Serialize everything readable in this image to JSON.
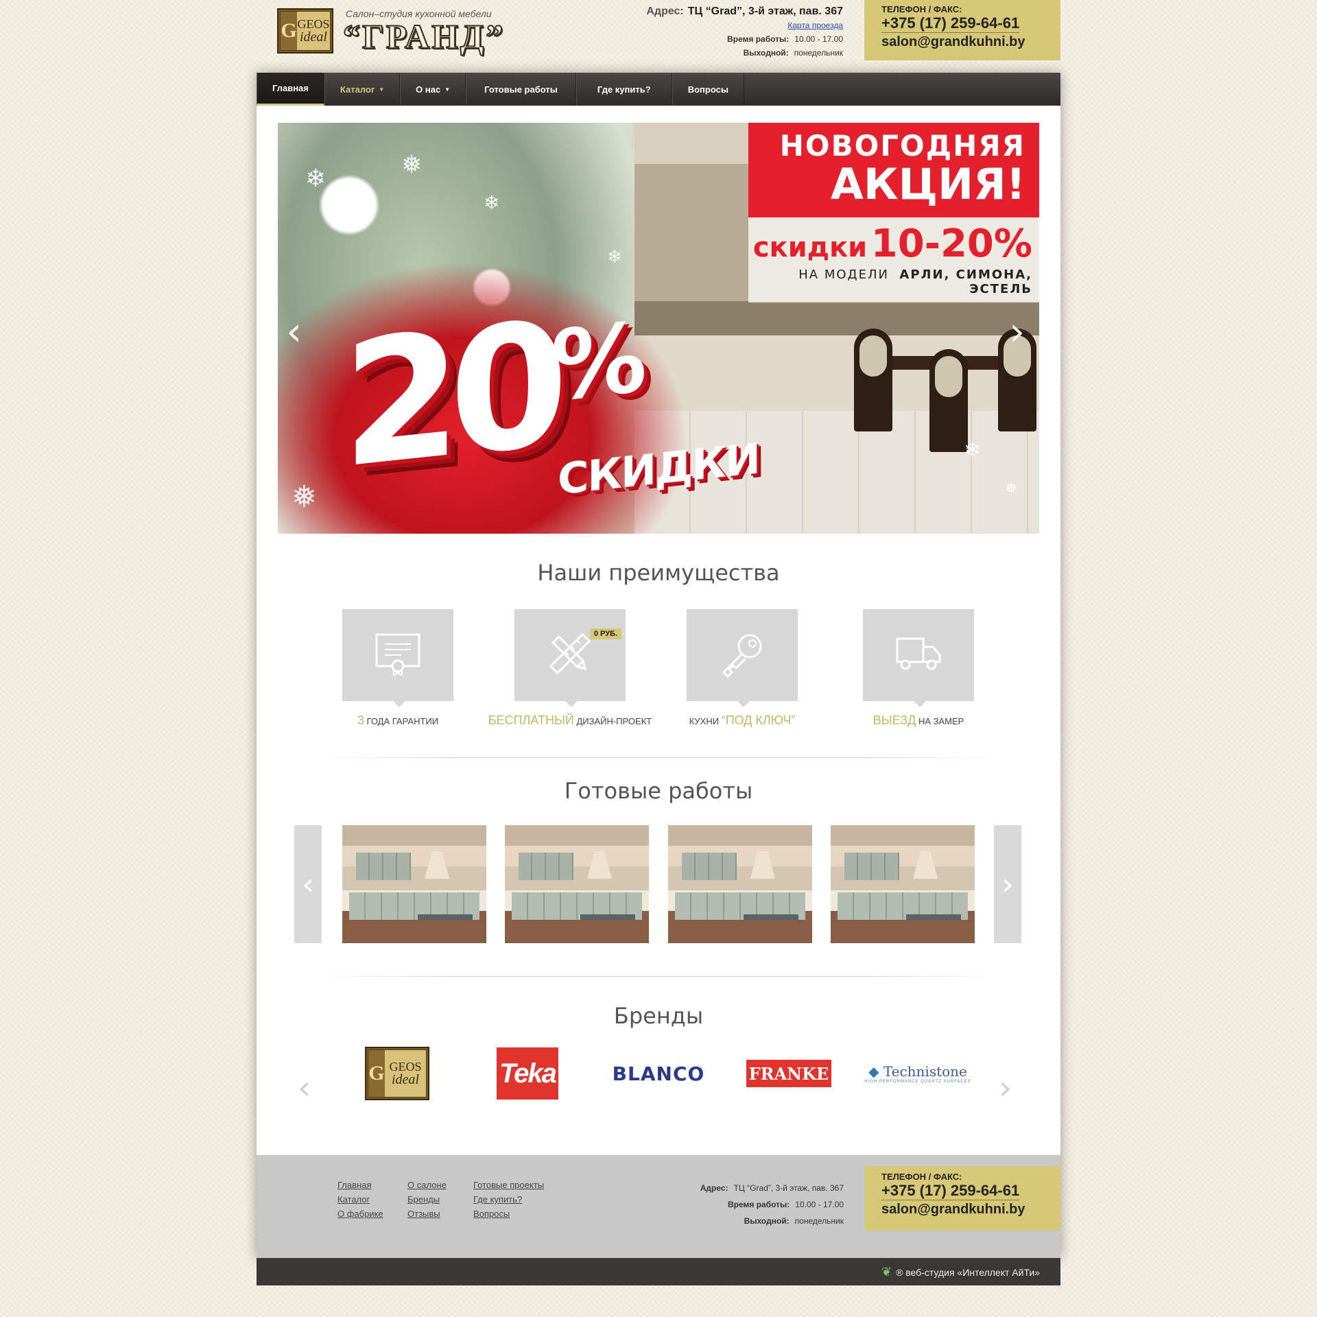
{
  "header": {
    "logo": {
      "letter": "G",
      "line1": "GEOS",
      "line2": "ideal"
    },
    "tagline": "Салон–студия кухонной мебели",
    "brand_name": "“ГРАНД”",
    "address_label": "Адрес:",
    "address": "ТЦ “Grad”, 3-й этаж, пав. 367",
    "map_link": "Карта проезда",
    "hours_label": "Время работы:",
    "hours": "10.00 - 17.00",
    "dayoff_label": "Выходной:",
    "dayoff": "понедельник",
    "contact_label": "ТЕЛЕФОН / ФАКС:",
    "phone": "+375 (17) 259-64-61",
    "email": "salon@grandkuhni.by"
  },
  "nav": [
    {
      "label": "Главная"
    },
    {
      "label": "Каталог"
    },
    {
      "label": "О нас"
    },
    {
      "label": "Готовые работы"
    },
    {
      "label": "Где купить?"
    },
    {
      "label": "Вопросы"
    }
  ],
  "banner": {
    "promo_line1": "НОВОГОДНЯЯ",
    "promo_line2": "АКЦИЯ!",
    "discount_word": "скидки",
    "discount_range": "10-20%",
    "models_prefix": "НА МОДЕЛИ",
    "models": "АРЛИ, СИМОНА, ЭСТЕЛЬ",
    "big_number": "20",
    "big_percent": "%",
    "big_word": "СКИДКИ",
    "arrow_prev": "‹",
    "arrow_next": "›"
  },
  "advantages": {
    "title": "Наши преимущества",
    "items": [
      {
        "icon": "certificate-icon",
        "gold": "3",
        "text": "года гарантии"
      },
      {
        "icon": "pencil-ruler-icon",
        "badge": "0 РУБ.",
        "gold": "бесплатный",
        "text": "дизайн-проект"
      },
      {
        "icon": "key-icon",
        "pre": "кухни",
        "gold": "“под ключ”"
      },
      {
        "icon": "truck-icon",
        "gold": "выезд",
        "text": "на замер"
      }
    ]
  },
  "works": {
    "title": "Готовые работы",
    "arrow_prev": "‹",
    "arrow_next": "›"
  },
  "brands": {
    "title": "Бренды",
    "arrow_prev": "‹",
    "arrow_next": "›",
    "items": [
      {
        "name": "GEOS ideal"
      },
      {
        "name": "Teka"
      },
      {
        "name": "BLANCO"
      },
      {
        "name": "FRANKE"
      },
      {
        "name": "Technistone",
        "sub": "HIGH PERFORMANCE QUARTZ SURFACES"
      }
    ]
  },
  "footer": {
    "col1": [
      "Главная",
      "Каталог",
      "О фабрике"
    ],
    "col2": [
      "О салоне",
      "Бренды",
      "Отзывы"
    ],
    "col3": [
      "Готовые проекты",
      "Где купить?",
      "Вопросы"
    ],
    "address_label": "Адрес:",
    "address": "ТЦ “Grad”, 3-й этаж, пав. 367",
    "hours_label": "Время работы:",
    "hours": "10.00 - 17.00",
    "dayoff_label": "Выходной:",
    "dayoff": "понедельник",
    "contact_label": "ТЕЛЕФОН / ФАКС:",
    "phone": "+375 (17) 259-64-61",
    "email": "salon@grandkuhni.by",
    "developer": "® веб-студия «Интеллект АйТи»"
  },
  "colors": {
    "gold": "#d6c876",
    "promo_red": "#e3202b",
    "nav_dark": "#3a3836"
  }
}
